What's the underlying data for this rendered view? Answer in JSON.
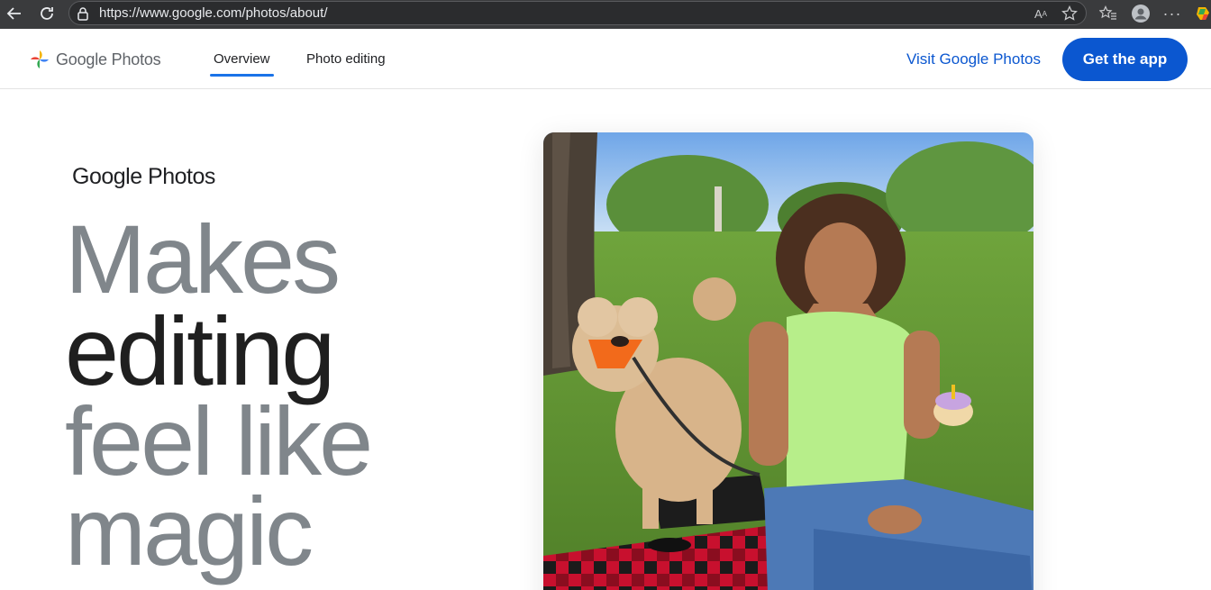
{
  "browser": {
    "url": "https://www.google.com/photos/about/"
  },
  "header": {
    "logo_text": "Google Photos",
    "tabs": [
      {
        "label": "Overview",
        "active": true
      },
      {
        "label": "Photo editing",
        "active": false
      }
    ],
    "visit_link": "Visit Google Photos",
    "cta_button": "Get the app"
  },
  "hero": {
    "brand": "Google Photos",
    "headline": [
      "Makes",
      "editing",
      "feel like",
      "magic"
    ]
  },
  "colors": {
    "accent": "#0b57d0",
    "tab_underline": "#1a73e8",
    "headline_grey": "#80868b",
    "headline_dark": "#1f1f1f"
  },
  "icons": [
    "back-icon",
    "reload-icon",
    "lock-icon",
    "read-aloud-icon",
    "star-icon",
    "favorites-icon",
    "profile-icon",
    "more-icon",
    "google-photos-pinwheel-icon"
  ]
}
